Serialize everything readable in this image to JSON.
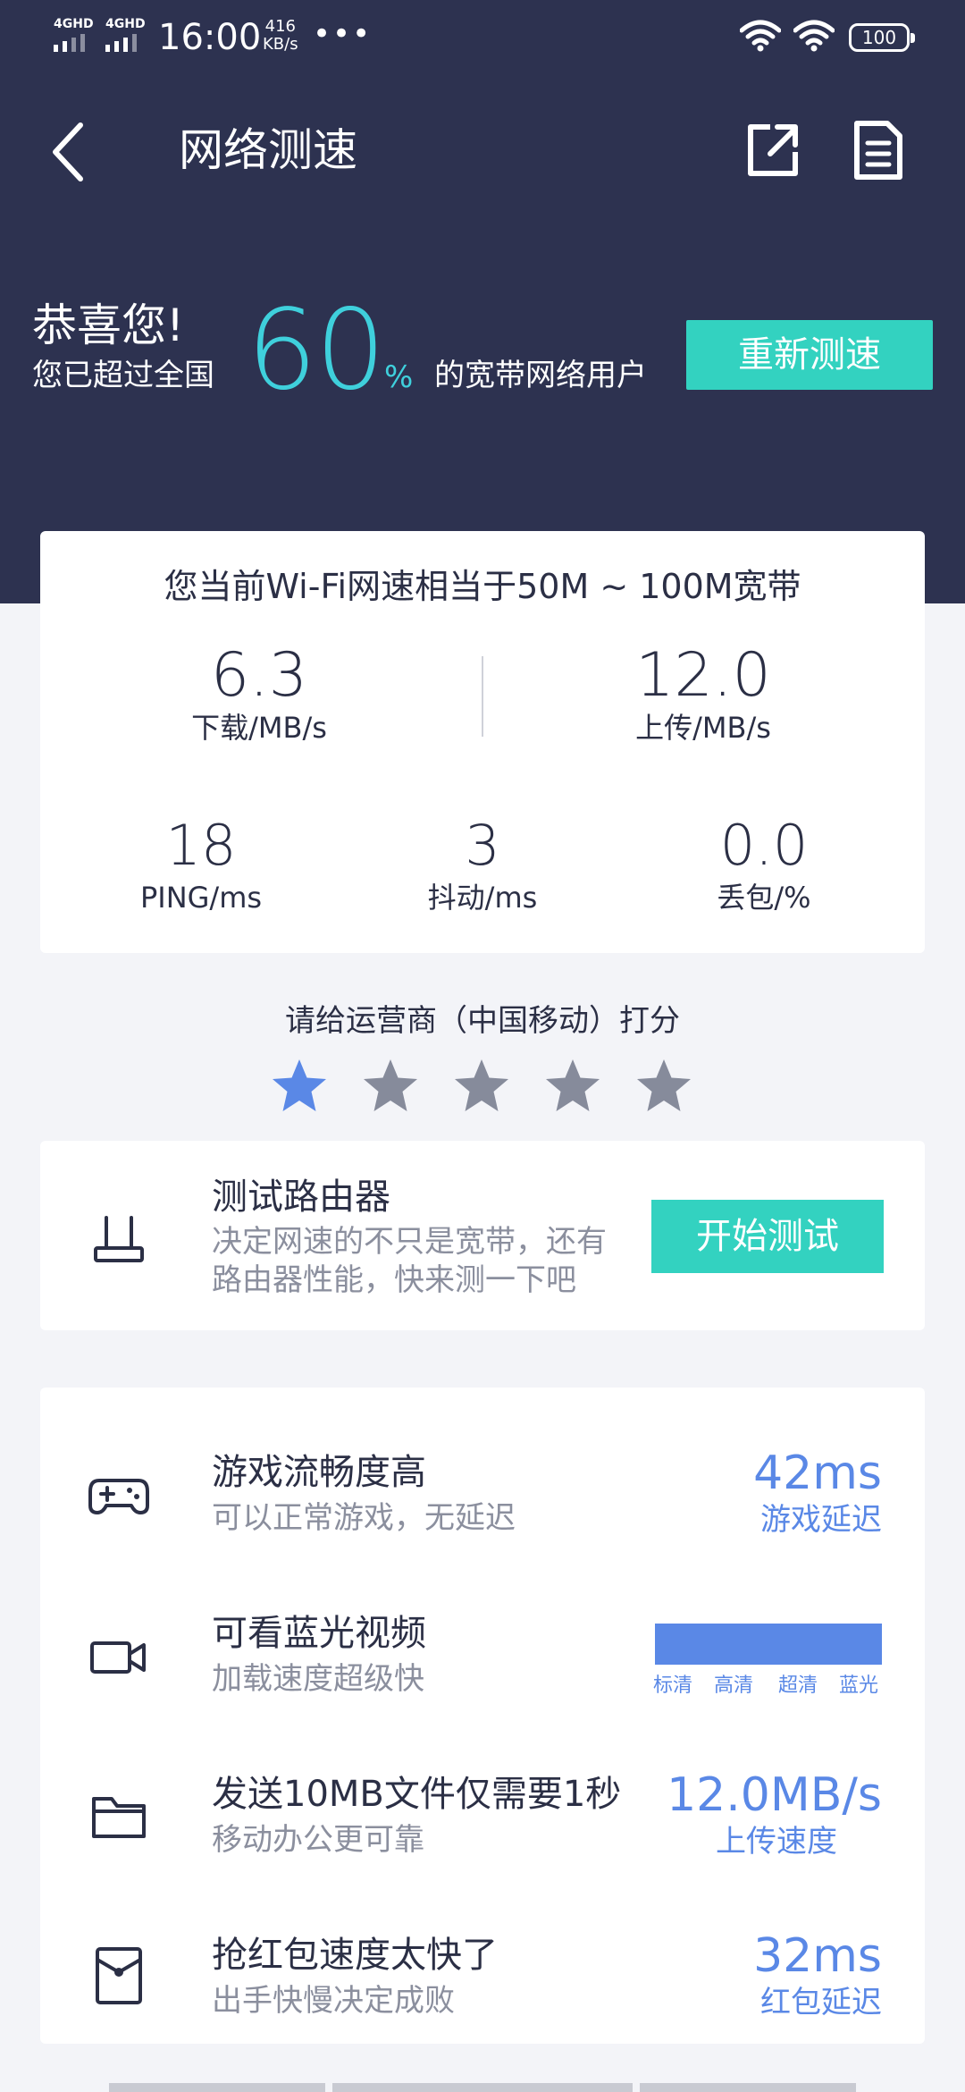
{
  "status_bar": {
    "network_1": "4GHD",
    "network_2": "4GHD",
    "time": "16:00",
    "speed_value": "416",
    "speed_unit": "KB/s",
    "dots": "•••",
    "battery": "100"
  },
  "nav": {
    "title": "网络测速",
    "back_icon": "chevron-left-icon",
    "share_icon": "share-icon",
    "doc_icon": "document-icon"
  },
  "congrats": {
    "title": "恭喜您!",
    "prefix": "您已超过全国",
    "percent": "60",
    "percent_sign": "%",
    "suffix": "的宽带网络用户",
    "retest_label": "重新测速"
  },
  "result": {
    "summary": "您当前Wi-Fi网速相当于50M ~ 100M宽带",
    "download": {
      "value": "6.3",
      "label": "下载/MB/s"
    },
    "upload": {
      "value": "12.0",
      "label": "上传/MB/s"
    },
    "ping": {
      "value": "18",
      "label": "PING/ms"
    },
    "jitter": {
      "value": "3",
      "label": "抖动/ms"
    },
    "loss": {
      "value": "0.0",
      "label": "丢包/%"
    }
  },
  "rating": {
    "prompt": "请给运营商（中国移动）打分",
    "stars_total": 5,
    "stars_selected": 1,
    "active_color": "#5a88e6",
    "inactive_color": "#868b9b"
  },
  "router": {
    "title": "测试路由器",
    "desc_line1": "决定网速的不只是宽带，还有",
    "desc_line2": "路由器性能，快来测一下吧",
    "button": "开始测试"
  },
  "features": {
    "game": {
      "title": "游戏流畅度高",
      "subtitle": "可以正常游戏，无延迟",
      "value": "42ms",
      "value_label": "游戏延迟"
    },
    "video": {
      "title": "可看蓝光视频",
      "subtitle": "加载速度超级快",
      "quality_labels": [
        "标清",
        "高清",
        "超清",
        "蓝光"
      ],
      "quality_level": 1.0
    },
    "file": {
      "title": "发送10MB文件仅需要1秒",
      "subtitle": "移动办公更可靠",
      "value": "12.0MB/s",
      "value_label": "上传速度"
    },
    "redpacket": {
      "title": "抢红包速度太快了",
      "subtitle": "出手快慢决定成败",
      "value": "32ms",
      "value_label": "红包延迟"
    }
  },
  "colors": {
    "header_bg": "#2d3250",
    "accent_teal": "#33d2c0",
    "accent_blue": "#5a88e6",
    "percent_cyan": "#3fd0dc"
  }
}
